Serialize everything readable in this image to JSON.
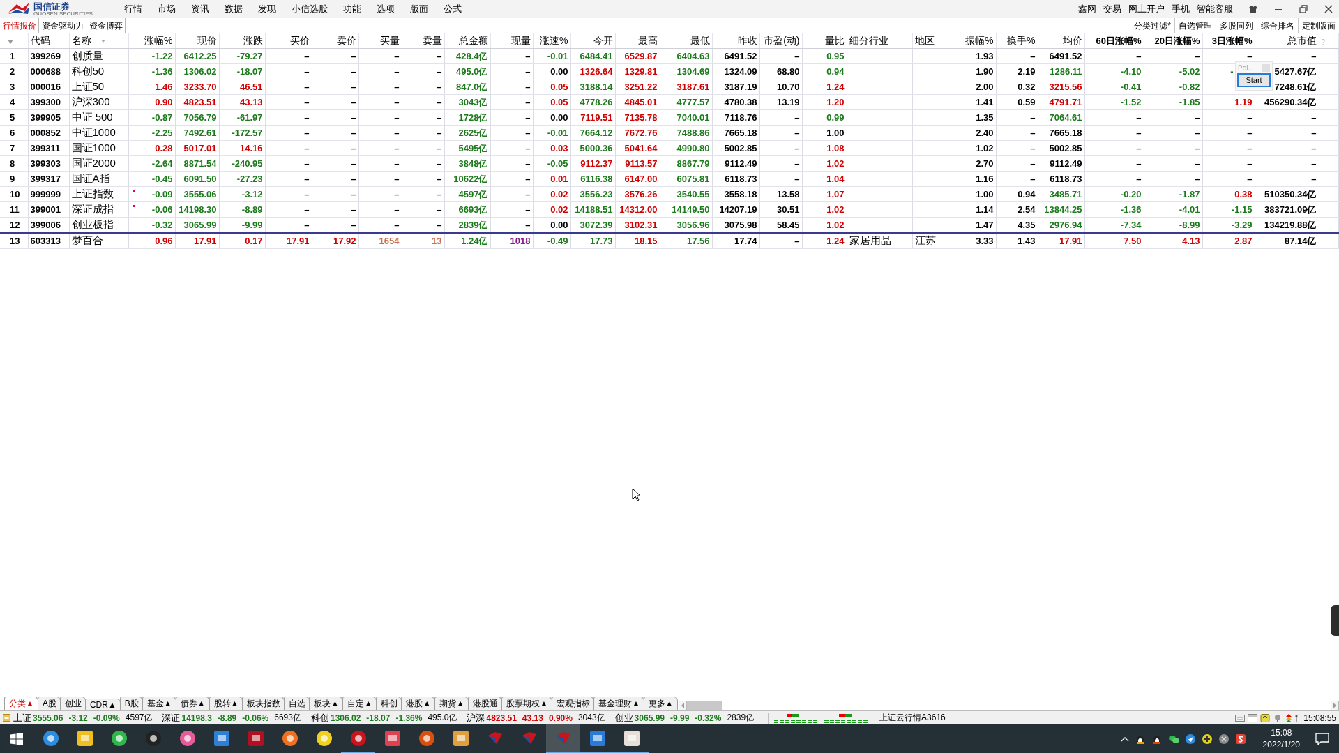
{
  "brand": {
    "name": "国信证券",
    "subtitle": "GUOSEN SECURITIES"
  },
  "menu": [
    "行情",
    "市场",
    "资讯",
    "数据",
    "发现",
    "小信选股",
    "功能",
    "选项",
    "版面",
    "公式"
  ],
  "top_links": [
    "鑫网",
    "交易",
    "网上开户",
    "手机",
    "智能客服"
  ],
  "view_tabs": [
    {
      "label": "行情报价",
      "selected": true
    },
    {
      "label": "资金驱动力",
      "selected": false
    },
    {
      "label": "资金博弈",
      "selected": false
    }
  ],
  "view_actions": [
    "分类过滤*",
    "自选管理",
    "多股同列",
    "综合排名",
    "定制版面"
  ],
  "table": {
    "columns": [
      "代码",
      "名称",
      "涨幅%",
      "现价",
      "涨跌",
      "买价",
      "卖价",
      "买量",
      "卖量",
      "总金额",
      "现量",
      "涨速%",
      "今开",
      "最高",
      "最低",
      "昨收",
      "市盈(动)",
      "量比",
      "细分行业",
      "地区",
      "振幅%",
      "换手%",
      "均价",
      "60日涨幅%",
      "20日涨幅%",
      "3日涨幅%",
      "总市值"
    ],
    "corner_mark": "?",
    "rows": [
      {
        "no": "1",
        "kind": "index",
        "flag": false,
        "cells": [
          {
            "text": "399269"
          },
          {
            "text": "创质量"
          },
          {
            "text": "-1.22",
            "color": "#1c7a1c"
          },
          {
            "text": "6412.25",
            "color": "#1c7a1c"
          },
          {
            "text": "-79.27",
            "color": "#1c7a1c"
          },
          {
            "text": "–"
          },
          {
            "text": "–"
          },
          {
            "text": "–"
          },
          {
            "text": "–"
          },
          {
            "text": "428.4亿",
            "color": "#1c7a1c"
          },
          {
            "text": "–"
          },
          {
            "text": "-0.01",
            "color": "#1c7a1c"
          },
          {
            "text": "6484.41",
            "color": "#1c7a1c"
          },
          {
            "text": "6529.87",
            "color": "#d00000"
          },
          {
            "text": "6404.63",
            "color": "#1c7a1c"
          },
          {
            "text": "6491.52"
          },
          {
            "text": "–"
          },
          {
            "text": "0.95",
            "color": "#1c7a1c"
          },
          {},
          {},
          {
            "text": "1.93"
          },
          {
            "text": "–"
          },
          {
            "text": "6491.52"
          },
          {
            "text": "–"
          },
          {
            "text": "–"
          },
          {
            "text": "–"
          },
          {
            "text": "–"
          }
        ]
      },
      {
        "no": "2",
        "kind": "index",
        "flag": false,
        "cells": [
          {
            "text": "000688"
          },
          {
            "text": "科创50"
          },
          {
            "text": "-1.36",
            "color": "#1c7a1c"
          },
          {
            "text": "1306.02",
            "color": "#1c7a1c"
          },
          {
            "text": "-18.07",
            "color": "#1c7a1c"
          },
          {
            "text": "–"
          },
          {
            "text": "–"
          },
          {
            "text": "–"
          },
          {
            "text": "–"
          },
          {
            "text": "495.0亿",
            "color": "#1c7a1c"
          },
          {
            "text": "–"
          },
          {
            "text": "0.00"
          },
          {
            "text": "1326.64",
            "color": "#d00000"
          },
          {
            "text": "1329.81",
            "color": "#d00000"
          },
          {
            "text": "1304.69",
            "color": "#1c7a1c"
          },
          {
            "text": "1324.09"
          },
          {
            "text": "68.80"
          },
          {
            "text": "0.94",
            "color": "#1c7a1c"
          },
          {},
          {},
          {
            "text": "1.90"
          },
          {
            "text": "2.19"
          },
          {
            "text": "1286.11",
            "color": "#1c7a1c"
          },
          {
            "text": "-4.10",
            "color": "#1c7a1c"
          },
          {
            "text": "-5.02",
            "color": "#1c7a1c"
          },
          {
            "text": "-",
            "color": "#1c7a1c",
            "covered": true
          },
          {
            "text": "5427.67亿"
          }
        ]
      },
      {
        "no": "3",
        "kind": "index",
        "flag": false,
        "cells": [
          {
            "text": "000016"
          },
          {
            "text": "上证50"
          },
          {
            "text": "1.46",
            "color": "#d00000"
          },
          {
            "text": "3233.70",
            "color": "#d00000"
          },
          {
            "text": "46.51",
            "color": "#d00000"
          },
          {
            "text": "–"
          },
          {
            "text": "–"
          },
          {
            "text": "–"
          },
          {
            "text": "–"
          },
          {
            "text": "847.0亿",
            "color": "#1c7a1c"
          },
          {
            "text": "–"
          },
          {
            "text": "0.05",
            "color": "#d00000"
          },
          {
            "text": "3188.14",
            "color": "#1c7a1c"
          },
          {
            "text": "3251.22",
            "color": "#d00000"
          },
          {
            "text": "3187.61",
            "color": "#d00000"
          },
          {
            "text": "3187.19"
          },
          {
            "text": "10.70"
          },
          {
            "text": "1.24",
            "color": "#d00000"
          },
          {},
          {},
          {
            "text": "2.00"
          },
          {
            "text": "0.32"
          },
          {
            "text": "3215.56",
            "color": "#d00000"
          },
          {
            "text": "-0.41",
            "color": "#1c7a1c"
          },
          {
            "text": "-0.82",
            "color": "#1c7a1c"
          },
          {},
          {
            "text": "7248.61亿"
          }
        ]
      },
      {
        "no": "4",
        "kind": "index",
        "flag": false,
        "cells": [
          {
            "text": "399300"
          },
          {
            "text": "沪深300"
          },
          {
            "text": "0.90",
            "color": "#d00000"
          },
          {
            "text": "4823.51",
            "color": "#d00000"
          },
          {
            "text": "43.13",
            "color": "#d00000"
          },
          {
            "text": "–"
          },
          {
            "text": "–"
          },
          {
            "text": "–"
          },
          {
            "text": "–"
          },
          {
            "text": "3043亿",
            "color": "#1c7a1c"
          },
          {
            "text": "–"
          },
          {
            "text": "0.05",
            "color": "#d00000"
          },
          {
            "text": "4778.26",
            "color": "#1c7a1c"
          },
          {
            "text": "4845.01",
            "color": "#d00000"
          },
          {
            "text": "4777.57",
            "color": "#1c7a1c"
          },
          {
            "text": "4780.38"
          },
          {
            "text": "13.19"
          },
          {
            "text": "1.20",
            "color": "#d00000"
          },
          {},
          {},
          {
            "text": "1.41"
          },
          {
            "text": "0.59"
          },
          {
            "text": "4791.71",
            "color": "#d00000"
          },
          {
            "text": "-1.52",
            "color": "#1c7a1c"
          },
          {
            "text": "-1.85",
            "color": "#1c7a1c"
          },
          {
            "text": "1.19",
            "color": "#d00000"
          },
          {
            "text": "456290.34亿"
          }
        ]
      },
      {
        "no": "5",
        "kind": "index",
        "flag": false,
        "cells": [
          {
            "text": "399905"
          },
          {
            "text": "中证 500"
          },
          {
            "text": "-0.87",
            "color": "#1c7a1c"
          },
          {
            "text": "7056.79",
            "color": "#1c7a1c"
          },
          {
            "text": "-61.97",
            "color": "#1c7a1c"
          },
          {
            "text": "–"
          },
          {
            "text": "–"
          },
          {
            "text": "–"
          },
          {
            "text": "–"
          },
          {
            "text": "1728亿",
            "color": "#1c7a1c"
          },
          {
            "text": "–"
          },
          {
            "text": "0.00"
          },
          {
            "text": "7119.51",
            "color": "#d00000"
          },
          {
            "text": "7135.78",
            "color": "#d00000"
          },
          {
            "text": "7040.01",
            "color": "#1c7a1c"
          },
          {
            "text": "7118.76"
          },
          {
            "text": "–"
          },
          {
            "text": "0.99",
            "color": "#1c7a1c"
          },
          {},
          {},
          {
            "text": "1.35"
          },
          {
            "text": "–"
          },
          {
            "text": "7064.61",
            "color": "#1c7a1c"
          },
          {
            "text": "–"
          },
          {
            "text": "–"
          },
          {
            "text": "–"
          },
          {
            "text": "–"
          }
        ]
      },
      {
        "no": "6",
        "kind": "index",
        "flag": false,
        "cells": [
          {
            "text": "000852"
          },
          {
            "text": "中证1000"
          },
          {
            "text": "-2.25",
            "color": "#1c7a1c"
          },
          {
            "text": "7492.61",
            "color": "#1c7a1c"
          },
          {
            "text": "-172.57",
            "color": "#1c7a1c"
          },
          {
            "text": "–"
          },
          {
            "text": "–"
          },
          {
            "text": "–"
          },
          {
            "text": "–"
          },
          {
            "text": "2625亿",
            "color": "#1c7a1c"
          },
          {
            "text": "–"
          },
          {
            "text": "-0.01",
            "color": "#1c7a1c"
          },
          {
            "text": "7664.12",
            "color": "#1c7a1c"
          },
          {
            "text": "7672.76",
            "color": "#d00000"
          },
          {
            "text": "7488.86",
            "color": "#1c7a1c"
          },
          {
            "text": "7665.18"
          },
          {
            "text": "–"
          },
          {
            "text": "1.00"
          },
          {},
          {},
          {
            "text": "2.40"
          },
          {
            "text": "–"
          },
          {
            "text": "7665.18"
          },
          {
            "text": "–"
          },
          {
            "text": "–"
          },
          {
            "text": "–"
          },
          {
            "text": "–"
          }
        ]
      },
      {
        "no": "7",
        "kind": "index",
        "flag": false,
        "cells": [
          {
            "text": "399311"
          },
          {
            "text": "国证1000"
          },
          {
            "text": "0.28",
            "color": "#d00000"
          },
          {
            "text": "5017.01",
            "color": "#d00000"
          },
          {
            "text": "14.16",
            "color": "#d00000"
          },
          {
            "text": "–"
          },
          {
            "text": "–"
          },
          {
            "text": "–"
          },
          {
            "text": "–"
          },
          {
            "text": "5495亿",
            "color": "#1c7a1c"
          },
          {
            "text": "–"
          },
          {
            "text": "0.03",
            "color": "#d00000"
          },
          {
            "text": "5000.36",
            "color": "#1c7a1c"
          },
          {
            "text": "5041.64",
            "color": "#d00000"
          },
          {
            "text": "4990.80",
            "color": "#1c7a1c"
          },
          {
            "text": "5002.85"
          },
          {
            "text": "–"
          },
          {
            "text": "1.08",
            "color": "#d00000"
          },
          {},
          {},
          {
            "text": "1.02"
          },
          {
            "text": "–"
          },
          {
            "text": "5002.85"
          },
          {
            "text": "–"
          },
          {
            "text": "–"
          },
          {
            "text": "–"
          },
          {
            "text": "–"
          }
        ]
      },
      {
        "no": "8",
        "kind": "index",
        "flag": false,
        "cells": [
          {
            "text": "399303"
          },
          {
            "text": "国证2000"
          },
          {
            "text": "-2.64",
            "color": "#1c7a1c"
          },
          {
            "text": "8871.54",
            "color": "#1c7a1c"
          },
          {
            "text": "-240.95",
            "color": "#1c7a1c"
          },
          {
            "text": "–"
          },
          {
            "text": "–"
          },
          {
            "text": "–"
          },
          {
            "text": "–"
          },
          {
            "text": "3848亿",
            "color": "#1c7a1c"
          },
          {
            "text": "–"
          },
          {
            "text": "-0.05",
            "color": "#1c7a1c"
          },
          {
            "text": "9112.37",
            "color": "#d00000"
          },
          {
            "text": "9113.57",
            "color": "#d00000"
          },
          {
            "text": "8867.79",
            "color": "#1c7a1c"
          },
          {
            "text": "9112.49"
          },
          {
            "text": "–"
          },
          {
            "text": "1.02",
            "color": "#d00000"
          },
          {},
          {},
          {
            "text": "2.70"
          },
          {
            "text": "–"
          },
          {
            "text": "9112.49"
          },
          {
            "text": "–"
          },
          {
            "text": "–"
          },
          {
            "text": "–"
          },
          {
            "text": "–"
          }
        ]
      },
      {
        "no": "9",
        "kind": "index",
        "flag": false,
        "cells": [
          {
            "text": "399317"
          },
          {
            "text": "国证A指"
          },
          {
            "text": "-0.45",
            "color": "#1c7a1c"
          },
          {
            "text": "6091.50",
            "color": "#1c7a1c"
          },
          {
            "text": "-27.23",
            "color": "#1c7a1c"
          },
          {
            "text": "–"
          },
          {
            "text": "–"
          },
          {
            "text": "–"
          },
          {
            "text": "–"
          },
          {
            "text": "10622亿",
            "color": "#1c7a1c"
          },
          {
            "text": "–"
          },
          {
            "text": "0.01",
            "color": "#d00000"
          },
          {
            "text": "6116.38",
            "color": "#1c7a1c"
          },
          {
            "text": "6147.00",
            "color": "#d00000"
          },
          {
            "text": "6075.81",
            "color": "#1c7a1c"
          },
          {
            "text": "6118.73"
          },
          {
            "text": "–"
          },
          {
            "text": "1.04",
            "color": "#d00000"
          },
          {},
          {},
          {
            "text": "1.16"
          },
          {
            "text": "–"
          },
          {
            "text": "6118.73"
          },
          {
            "text": "–"
          },
          {
            "text": "–"
          },
          {
            "text": "–"
          },
          {
            "text": "–"
          }
        ]
      },
      {
        "no": "10",
        "kind": "index",
        "flag": true,
        "cells": [
          {
            "text": "999999"
          },
          {
            "text": "上证指数"
          },
          {
            "text": "-0.09",
            "color": "#1c7a1c"
          },
          {
            "text": "3555.06",
            "color": "#1c7a1c"
          },
          {
            "text": "-3.12",
            "color": "#1c7a1c"
          },
          {
            "text": "–"
          },
          {
            "text": "–"
          },
          {
            "text": "–"
          },
          {
            "text": "–"
          },
          {
            "text": "4597亿",
            "color": "#1c7a1c"
          },
          {
            "text": "–"
          },
          {
            "text": "0.02",
            "color": "#d00000"
          },
          {
            "text": "3556.23",
            "color": "#1c7a1c"
          },
          {
            "text": "3576.26",
            "color": "#d00000"
          },
          {
            "text": "3540.55",
            "color": "#1c7a1c"
          },
          {
            "text": "3558.18"
          },
          {
            "text": "13.58"
          },
          {
            "text": "1.07",
            "color": "#d00000"
          },
          {},
          {},
          {
            "text": "1.00"
          },
          {
            "text": "0.94"
          },
          {
            "text": "3485.71",
            "color": "#1c7a1c"
          },
          {
            "text": "-0.20",
            "color": "#1c7a1c"
          },
          {
            "text": "-1.87",
            "color": "#1c7a1c"
          },
          {
            "text": "0.38",
            "color": "#d00000"
          },
          {
            "text": "510350.34亿"
          }
        ]
      },
      {
        "no": "11",
        "kind": "index",
        "flag": true,
        "cells": [
          {
            "text": "399001"
          },
          {
            "text": "深证成指"
          },
          {
            "text": "-0.06",
            "color": "#1c7a1c"
          },
          {
            "text": "14198.30",
            "color": "#1c7a1c"
          },
          {
            "text": "-8.89",
            "color": "#1c7a1c"
          },
          {
            "text": "–"
          },
          {
            "text": "–"
          },
          {
            "text": "–"
          },
          {
            "text": "–"
          },
          {
            "text": "6693亿",
            "color": "#1c7a1c"
          },
          {
            "text": "–"
          },
          {
            "text": "0.02",
            "color": "#d00000"
          },
          {
            "text": "14188.51",
            "color": "#1c7a1c"
          },
          {
            "text": "14312.00",
            "color": "#d00000"
          },
          {
            "text": "14149.50",
            "color": "#1c7a1c"
          },
          {
            "text": "14207.19"
          },
          {
            "text": "30.51"
          },
          {
            "text": "1.02",
            "color": "#d00000"
          },
          {},
          {},
          {
            "text": "1.14"
          },
          {
            "text": "2.54"
          },
          {
            "text": "13844.25",
            "color": "#1c7a1c"
          },
          {
            "text": "-1.36",
            "color": "#1c7a1c"
          },
          {
            "text": "-4.01",
            "color": "#1c7a1c"
          },
          {
            "text": "-1.15",
            "color": "#1c7a1c"
          },
          {
            "text": "383721.09亿"
          }
        ]
      },
      {
        "no": "12",
        "kind": "index",
        "flag": false,
        "cells": [
          {
            "text": "399006"
          },
          {
            "text": "创业板指"
          },
          {
            "text": "-0.32",
            "color": "#1c7a1c"
          },
          {
            "text": "3065.99",
            "color": "#1c7a1c"
          },
          {
            "text": "-9.99",
            "color": "#1c7a1c"
          },
          {
            "text": "–"
          },
          {
            "text": "–"
          },
          {
            "text": "–"
          },
          {
            "text": "–"
          },
          {
            "text": "2839亿",
            "color": "#1c7a1c"
          },
          {
            "text": "–"
          },
          {
            "text": "0.00"
          },
          {
            "text": "3072.39",
            "color": "#1c7a1c"
          },
          {
            "text": "3102.31",
            "color": "#d00000"
          },
          {
            "text": "3056.96",
            "color": "#1c7a1c"
          },
          {
            "text": "3075.98"
          },
          {
            "text": "58.45"
          },
          {
            "text": "1.02",
            "color": "#d00000"
          },
          {},
          {},
          {
            "text": "1.47"
          },
          {
            "text": "4.35"
          },
          {
            "text": "2976.94",
            "color": "#1c7a1c"
          },
          {
            "text": "-7.34",
            "color": "#1c7a1c"
          },
          {
            "text": "-8.99",
            "color": "#1c7a1c"
          },
          {
            "text": "-3.29",
            "color": "#1c7a1c"
          },
          {
            "text": "134219.88亿"
          }
        ]
      },
      {
        "no": "13",
        "kind": "stock",
        "flag": false,
        "cells": [
          {
            "text": "603313"
          },
          {
            "text": "梦百合"
          },
          {
            "text": "0.96",
            "color": "#d00000"
          },
          {
            "text": "17.91",
            "color": "#d00000"
          },
          {
            "text": "0.17",
            "color": "#d00000"
          },
          {
            "text": "17.91",
            "color": "#d00000"
          },
          {
            "text": "17.92",
            "color": "#d00000"
          },
          {
            "text": "1654",
            "color": "#c8704e"
          },
          {
            "text": "13",
            "color": "#c8704e"
          },
          {
            "text": "1.24亿",
            "color": "#1c7a1c"
          },
          {
            "text": "1018",
            "color": "#8a1a8a"
          },
          {
            "text": "-0.49",
            "color": "#1c7a1c"
          },
          {
            "text": "17.73",
            "color": "#1c7a1c"
          },
          {
            "text": "18.15",
            "color": "#d00000"
          },
          {
            "text": "17.56",
            "color": "#1c7a1c"
          },
          {
            "text": "17.74"
          },
          {
            "text": "–"
          },
          {
            "text": "1.24",
            "color": "#d00000"
          },
          {
            "text": "家居用品"
          },
          {
            "text": "江苏"
          },
          {
            "text": "3.33"
          },
          {
            "text": "1.43"
          },
          {
            "text": "17.91",
            "color": "#d00000"
          },
          {
            "text": "7.50",
            "color": "#d00000"
          },
          {
            "text": "4.13",
            "color": "#d00000"
          },
          {
            "text": "2.87",
            "color": "#d00000"
          },
          {
            "text": "87.14亿"
          }
        ]
      }
    ]
  },
  "overlay": {
    "title": "Poi...",
    "button": "Start"
  },
  "category_tabs": [
    {
      "label": "分类▲",
      "selected": true
    },
    {
      "label": "A股",
      "selected": false
    },
    {
      "label": "创业",
      "selected": false
    },
    {
      "label": "CDR▲",
      "selected": false
    },
    {
      "label": "B股",
      "selected": false
    },
    {
      "label": "基金▲",
      "selected": false
    },
    {
      "label": "债券▲",
      "selected": false
    },
    {
      "label": "股转▲",
      "selected": false
    },
    {
      "label": "板块指数",
      "selected": false
    },
    {
      "label": "自选",
      "selected": false
    },
    {
      "label": "板块▲",
      "selected": false
    },
    {
      "label": "自定▲",
      "selected": false
    },
    {
      "label": "科创",
      "selected": false
    },
    {
      "label": "港股▲",
      "selected": false
    },
    {
      "label": "期货▲",
      "selected": false
    },
    {
      "label": "港股通",
      "selected": false
    },
    {
      "label": "股票期权▲",
      "selected": false
    },
    {
      "label": "宏观指标",
      "selected": false
    },
    {
      "label": "基金理财▲",
      "selected": false
    },
    {
      "label": "更多▲",
      "selected": false
    }
  ],
  "ticker": [
    {
      "kind": "name",
      "text": "上证"
    },
    {
      "kind": "value",
      "text": "3555.06",
      "color": "#1c7a1c"
    },
    {
      "kind": "value",
      "text": "-3.12",
      "color": "#1c7a1c"
    },
    {
      "kind": "value",
      "text": "-0.09%",
      "color": "#1c7a1c"
    },
    {
      "kind": "amount",
      "text": "4597亿"
    },
    {
      "kind": "name",
      "text": "深证"
    },
    {
      "kind": "value",
      "text": "14198.3",
      "color": "#1c7a1c"
    },
    {
      "kind": "value",
      "text": "-8.89",
      "color": "#1c7a1c"
    },
    {
      "kind": "value",
      "text": "-0.06%",
      "color": "#1c7a1c"
    },
    {
      "kind": "amount",
      "text": "6693亿"
    },
    {
      "kind": "name",
      "text": "科创"
    },
    {
      "kind": "value",
      "text": "1306.02",
      "color": "#1c7a1c"
    },
    {
      "kind": "value",
      "text": "-18.07",
      "color": "#1c7a1c"
    },
    {
      "kind": "value",
      "text": "-1.36%",
      "color": "#1c7a1c"
    },
    {
      "kind": "amount",
      "text": "495.0亿"
    },
    {
      "kind": "name",
      "text": "沪深"
    },
    {
      "kind": "value",
      "text": "4823.51",
      "color": "#d00000"
    },
    {
      "kind": "value",
      "text": "43.13",
      "color": "#d00000"
    },
    {
      "kind": "value",
      "text": "0.90%",
      "color": "#d00000"
    },
    {
      "kind": "amount",
      "text": "3043亿"
    },
    {
      "kind": "name",
      "text": "创业"
    },
    {
      "kind": "value",
      "text": "3065.99",
      "color": "#1c7a1c"
    },
    {
      "kind": "value",
      "text": "-9.99",
      "color": "#1c7a1c"
    },
    {
      "kind": "value",
      "text": "-0.32%",
      "color": "#1c7a1c"
    },
    {
      "kind": "amount",
      "text": "2839亿"
    }
  ],
  "status_text": "上证云行情A3616",
  "clock": "15:08:55",
  "taskbar": {
    "apps": [
      {
        "running": false,
        "selected": false
      },
      {
        "running": false,
        "selected": false
      },
      {
        "running": false,
        "selected": false
      },
      {
        "running": false,
        "selected": false
      },
      {
        "running": false,
        "selected": false
      },
      {
        "running": false,
        "selected": false
      },
      {
        "running": false,
        "selected": false
      },
      {
        "running": false,
        "selected": false
      },
      {
        "running": false,
        "selected": false
      },
      {
        "running": true,
        "selected": false
      },
      {
        "running": false,
        "selected": false
      },
      {
        "running": false,
        "selected": false
      },
      {
        "running": false,
        "selected": false
      },
      {
        "running": false,
        "selected": false
      },
      {
        "running": false,
        "selected": false
      },
      {
        "running": true,
        "selected": true
      },
      {
        "running": true,
        "selected": false
      },
      {
        "running": true,
        "selected": false
      }
    ],
    "time": "15:08",
    "date": "2022/1/20"
  }
}
